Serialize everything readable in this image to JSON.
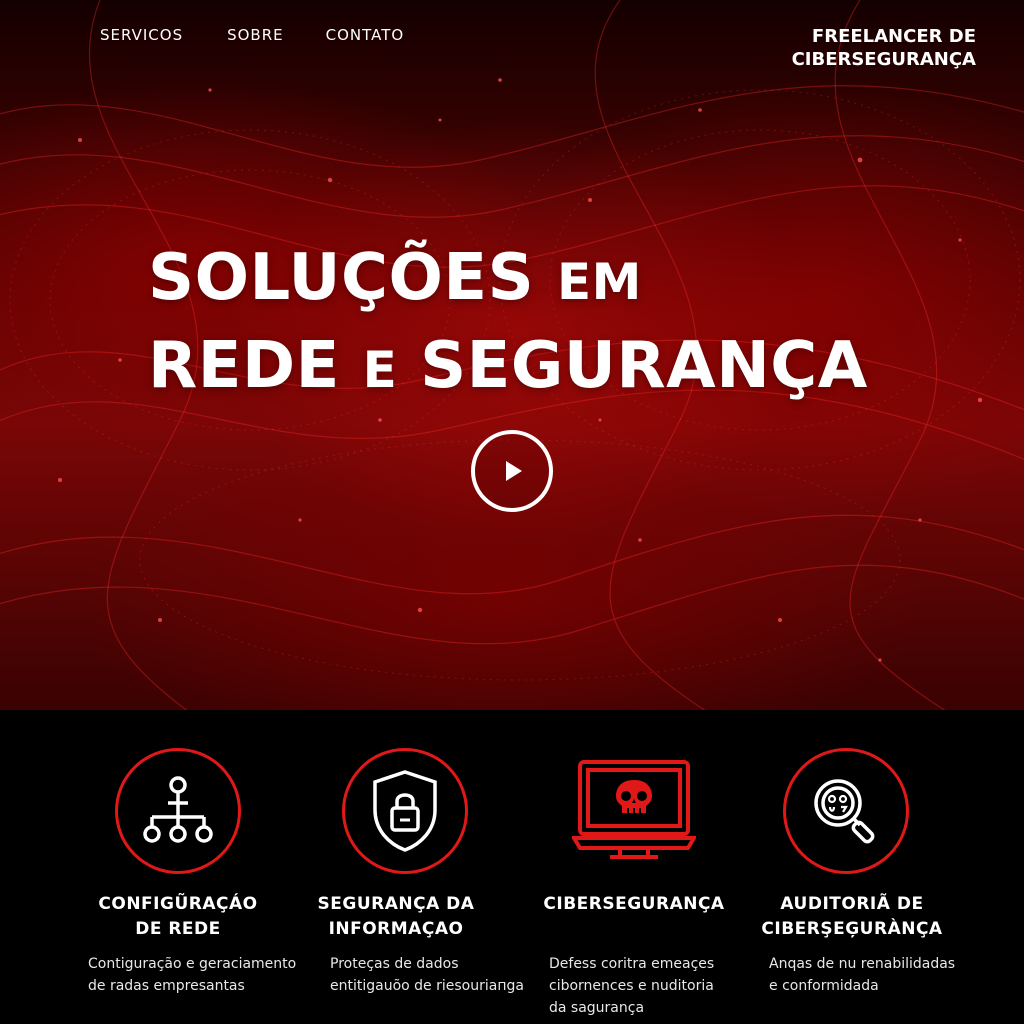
{
  "nav": {
    "items": [
      {
        "label": "SERVICOS"
      },
      {
        "label": "SOBRE"
      },
      {
        "label": "CONTATO"
      }
    ]
  },
  "brand": {
    "line1": "FREELANCER DE",
    "line2": "CIBERSEGURANÇA"
  },
  "hero": {
    "title_word1": "SOLUÇÕES",
    "title_word2": "EM",
    "title_word3": "REDE",
    "title_word4": "E",
    "title_word5": "SEGURANÇA",
    "play_icon": "play-icon"
  },
  "services": [
    {
      "icon": "network-hierarchy-icon",
      "title_line1": "CONFIGŨRAÇÁO",
      "title_line2": "DE REDE",
      "desc_line1": "Contiguração e geraciamento",
      "desc_line2": "de radas empresantas",
      "desc_line3": ""
    },
    {
      "icon": "shield-lock-icon",
      "title_line1": "SEGURANÇA DA",
      "title_line2": "INFORMAÇAO",
      "desc_line1": "Proteças de dados",
      "desc_line2": "entitigauõo de riesouriaпga",
      "desc_line3": ""
    },
    {
      "icon": "monitor-skull-icon",
      "title_line1": "CIBERSEGURANÇA",
      "title_line2": "",
      "desc_line1": "Defess coritra emeaçes",
      "desc_line2": "cibornences e nuditoria",
      "desc_line3": "da saguranҫa"
    },
    {
      "icon": "magnifier-audit-icon",
      "title_line1": "AUDITORIÃ DE",
      "title_line2": "CIBERŞEĢURÀNÇA",
      "desc_line1": "Anqas de nu renabilidadas",
      "desc_line2": "e conformidada",
      "desc_line3": ""
    }
  ],
  "colors": {
    "accent_red": "#e01818",
    "hero_dark": "#140000",
    "hero_mid": "#7a0606",
    "text": "#ffffff",
    "section_bg": "#000000"
  }
}
